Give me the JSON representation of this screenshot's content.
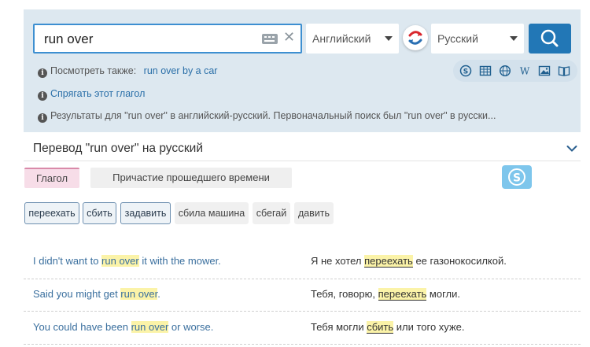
{
  "search": {
    "query": "run over",
    "source_lang": "Английский",
    "target_lang": "Русский"
  },
  "info": {
    "see_also_label": "Посмотреть также:",
    "see_also_link": "run over by a car",
    "conjugate": "Спрягать этот глагол",
    "results_note": "Результаты для \"run over\" в английский-русский. Первоначальный поиск был \"run over\" в русски..."
  },
  "translation": {
    "title": "Перевод \"run over\" на русский"
  },
  "pos_tabs": [
    "Глагол",
    "Причастие прошедшего времени"
  ],
  "synonyms": [
    "переехать",
    "сбить",
    "задавить",
    "сбила машина",
    "сбегай",
    "давить"
  ],
  "examples": [
    {
      "src_before": "I didn't want to ",
      "src_hl": "run over",
      "src_after": " it with the mower.",
      "tgt_before": "Я не хотел ",
      "tgt_hl": "переехать",
      "tgt_after": " ее газонокосилкой."
    },
    {
      "src_before": "Said you might get ",
      "src_hl": "run over",
      "src_after": ".",
      "tgt_before": "Тебя, говорю, ",
      "tgt_hl": "переехать",
      "tgt_after": " могли."
    },
    {
      "src_before": "You could have been ",
      "src_hl": "run over",
      "src_after": " or worse.",
      "tgt_before": "Тебя могли ",
      "tgt_hl": "сбить",
      "tgt_after": " или того хуже."
    }
  ],
  "colors": {
    "accent": "#2277b6",
    "panel": "#dde8f0",
    "highlight": "#fbf3a8",
    "verb_tab": "#f7dde8",
    "skype": "#7ec6ec"
  },
  "icons": [
    "keyboard-icon",
    "clear-icon",
    "swap-languages-icon",
    "search-icon",
    "info-icon",
    "skype-icon",
    "table-icon",
    "globe-icon",
    "wikipedia-icon",
    "image-icon",
    "book-icon",
    "chevron-down-icon"
  ]
}
